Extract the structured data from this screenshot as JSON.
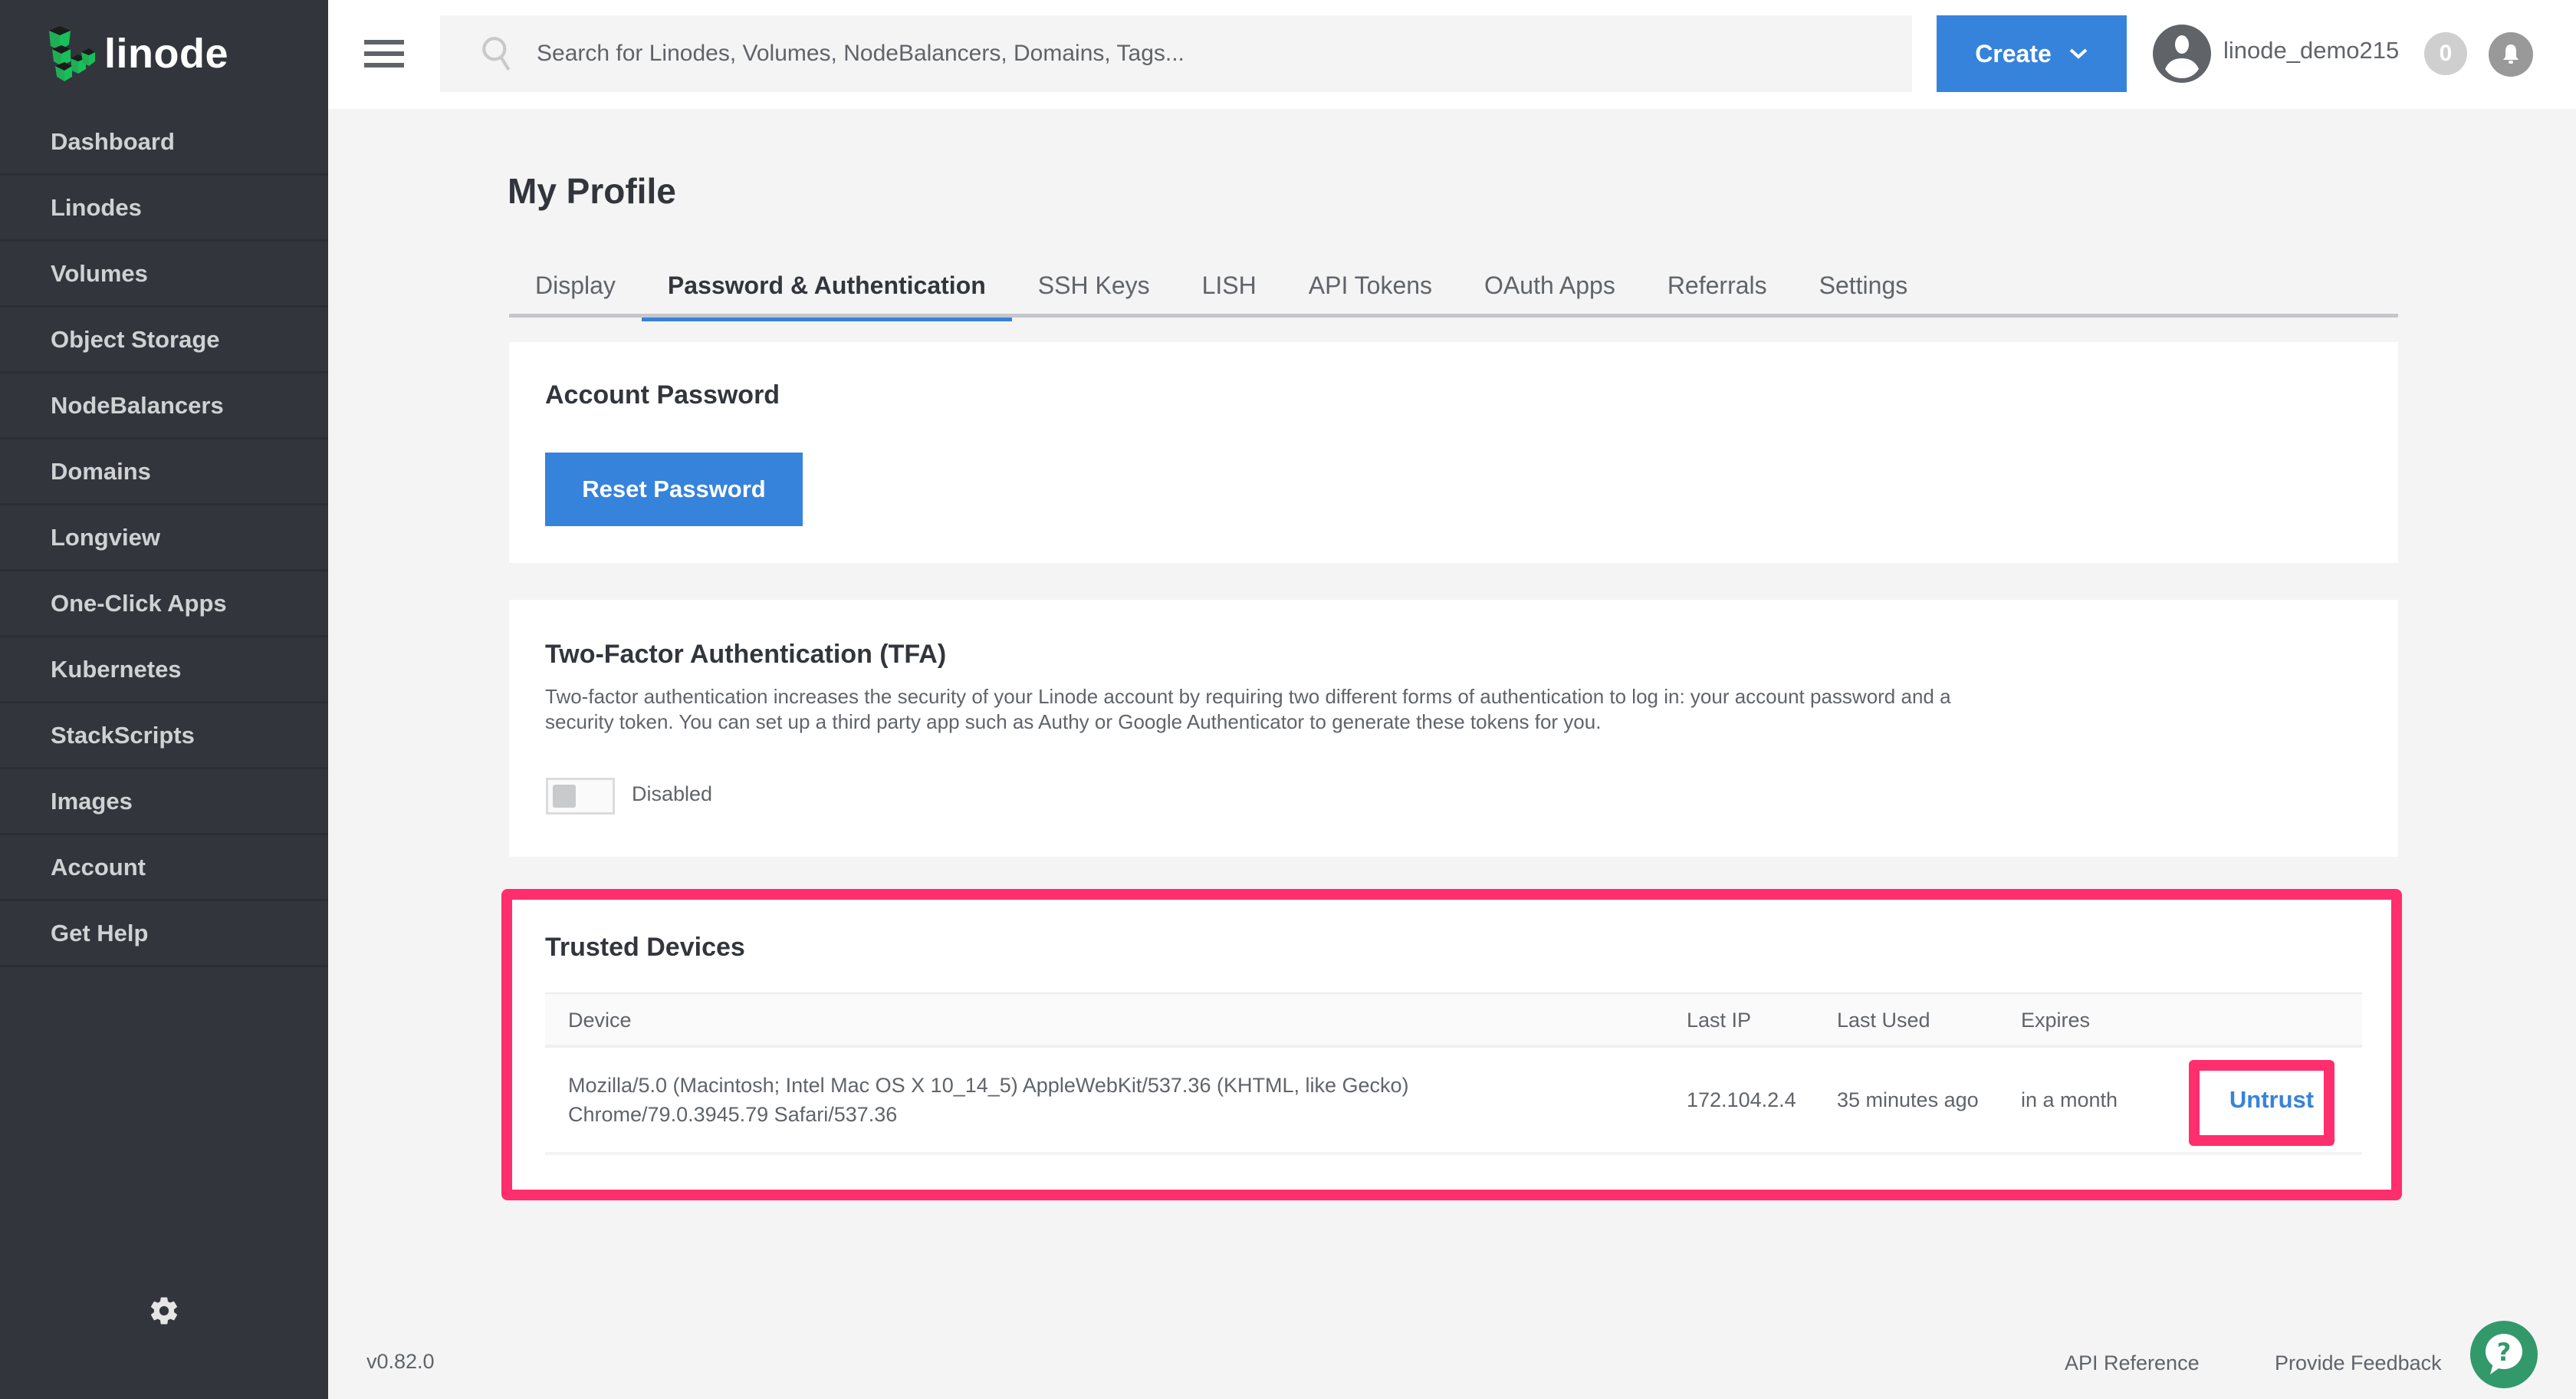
{
  "app": {
    "brand": "linode",
    "version": "v0.82.0"
  },
  "sidebar": {
    "items": [
      {
        "label": "Dashboard"
      },
      {
        "label": "Linodes"
      },
      {
        "label": "Volumes"
      },
      {
        "label": "Object Storage"
      },
      {
        "label": "NodeBalancers"
      },
      {
        "label": "Domains"
      },
      {
        "label": "Longview"
      },
      {
        "label": "One-Click Apps"
      },
      {
        "label": "Kubernetes"
      },
      {
        "label": "StackScripts"
      },
      {
        "label": "Images"
      },
      {
        "label": "Account"
      },
      {
        "label": "Get Help"
      }
    ],
    "settings_icon": "gear-icon"
  },
  "topbar": {
    "menu_icon": "hamburger-icon",
    "search_placeholder": "Search for Linodes, Volumes, NodeBalancers, Domains, Tags...",
    "search_value": "",
    "create_label": "Create",
    "username": "linode_demo215",
    "notification_count": "0"
  },
  "page": {
    "title": "My Profile",
    "tabs": [
      {
        "label": "Display",
        "active": false
      },
      {
        "label": "Password & Authentication",
        "active": true
      },
      {
        "label": "SSH Keys",
        "active": false
      },
      {
        "label": "LISH",
        "active": false
      },
      {
        "label": "API Tokens",
        "active": false
      },
      {
        "label": "OAuth Apps",
        "active": false
      },
      {
        "label": "Referrals",
        "active": false
      },
      {
        "label": "Settings",
        "active": false
      }
    ]
  },
  "account_password": {
    "title": "Account Password",
    "reset_label": "Reset Password"
  },
  "tfa": {
    "title": "Two-Factor Authentication (TFA)",
    "description": "Two-factor authentication increases the security of your Linode account by requiring two different forms of authentication to log in: your account password and a security token. You can set up a third party app such as Authy or Google Authenticator to generate these tokens for you.",
    "enabled": false,
    "status_label": "Disabled"
  },
  "trusted_devices": {
    "title": "Trusted Devices",
    "columns": [
      "Device",
      "Last IP",
      "Last Used",
      "Expires"
    ],
    "rows": [
      {
        "device_line1": "Mozilla/5.0 (Macintosh; Intel Mac OS X 10_14_5) AppleWebKit/537.36 (KHTML, like Gecko)",
        "device_line2": "Chrome/79.0.3945.79 Safari/537.36",
        "last_ip": "172.104.2.4",
        "last_used": "35 minutes ago",
        "expires": "in a month",
        "action_label": "Untrust"
      }
    ]
  },
  "footer": {
    "api_reference": "API Reference",
    "feedback": "Provide Feedback",
    "help_icon": "help-chat-icon"
  },
  "colors": {
    "accent": "#3683dc",
    "sidebar_bg": "#32363c",
    "highlight": "#ff2e6c",
    "help_fab": "#32996a"
  }
}
